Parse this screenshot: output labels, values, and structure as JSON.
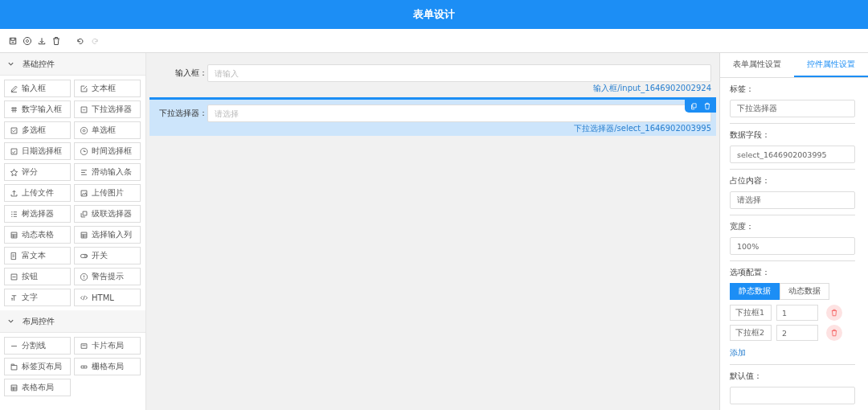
{
  "header": {
    "title": "表单设计"
  },
  "palette": [
    {
      "title": "基础控件",
      "expanded": true,
      "items": [
        "输入框",
        "文本框",
        "数字输入框",
        "下拉选择器",
        "多选框",
        "单选框",
        "日期选择框",
        "时间选择框",
        "评分",
        "滑动输入条",
        "上传文件",
        "上传图片",
        "树选择器",
        "级联选择器",
        "动态表格",
        "选择输入列",
        "富文本",
        "开关",
        "按钮",
        "警告提示",
        "文字",
        "HTML"
      ]
    },
    {
      "title": "布局控件",
      "expanded": true,
      "items": [
        "分割线",
        "卡片布局",
        "标签页布局",
        "栅格布局",
        "表格布局"
      ]
    }
  ],
  "canvas": {
    "fields": [
      {
        "label": "输入框：",
        "placeholder": "请输入",
        "caption": "输入框/input_1646902002924",
        "selected": false
      },
      {
        "label": "下拉选择器：",
        "placeholder": "请选择",
        "caption": "下拉选择器/select_1646902003995",
        "selected": true
      }
    ]
  },
  "properties": {
    "tabs": [
      {
        "label": "表单属性设置",
        "selected": false
      },
      {
        "label": "控件属性设置",
        "selected": true
      }
    ],
    "fields": [
      {
        "label": "标签：",
        "value": "下拉选择器"
      },
      {
        "label": "数据字段：",
        "value": "select_1646902003995"
      },
      {
        "label": "占位内容：",
        "value": "请选择"
      },
      {
        "label": "宽度：",
        "value": "100%"
      }
    ],
    "options_label": "选项配置：",
    "source_tabs": [
      {
        "label": "静态数据",
        "selected": true
      },
      {
        "label": "动态数据",
        "selected": false
      }
    ],
    "options": [
      {
        "label": "下拉框1",
        "value": "1"
      },
      {
        "label": "下拉框2",
        "value": "2"
      }
    ],
    "add_link": "添加",
    "default_label": "默认值："
  }
}
